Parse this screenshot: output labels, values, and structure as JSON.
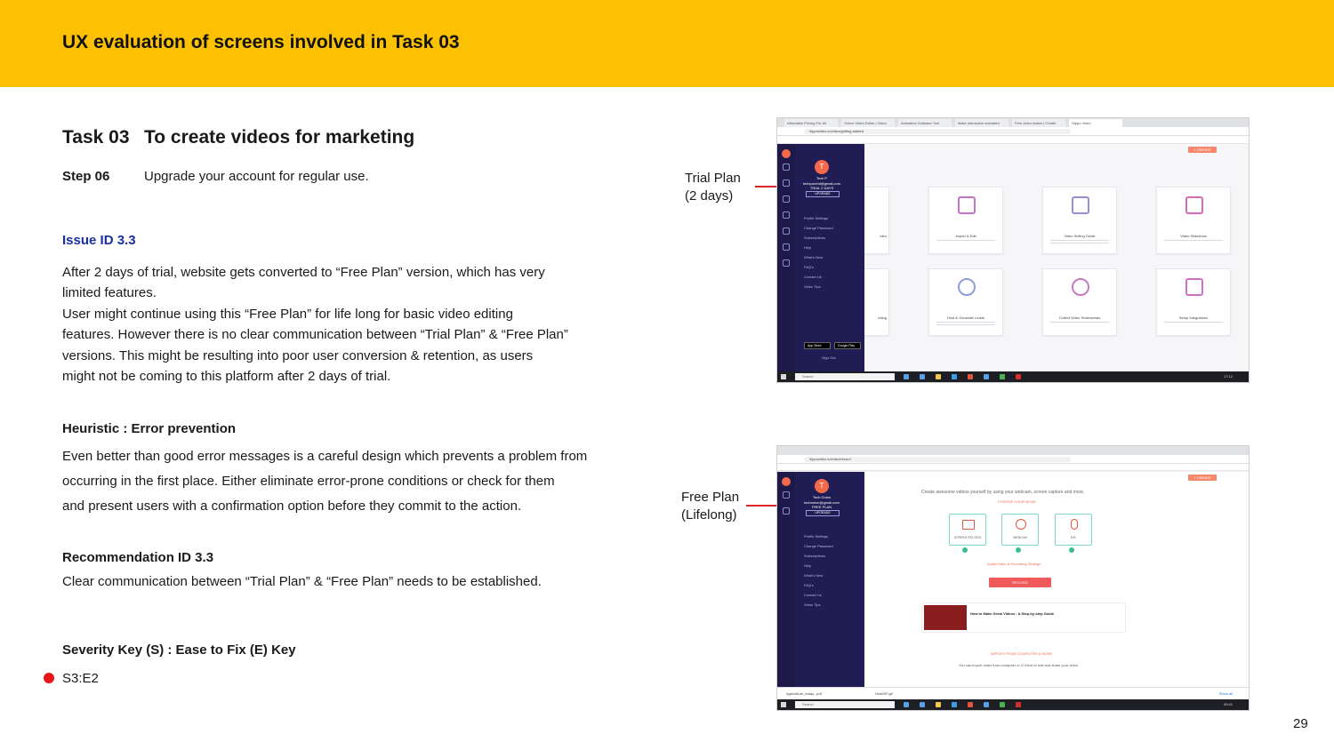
{
  "header": {
    "title": "UX evaluation of screens involved in Task 03"
  },
  "task": {
    "label": "Task 03",
    "title": "To create videos for marketing"
  },
  "step": {
    "label": "Step 06",
    "text": "Upgrade your account for regular use."
  },
  "issue": {
    "id": "Issue ID 3.3",
    "lines": [
      "After 2 days of trial,  website gets converted to “Free Plan” version, which has very",
      "limited features.",
      "User might continue using this “Free Plan” for life long for basic video editing",
      "features. However there is no clear communication between “Trial Plan” & “Free Plan”",
      "versions. This might be resulting into poor user conversion & retention, as users",
      "might not be coming to this platform after 2 days of trial."
    ]
  },
  "heuristic": {
    "title": "Heuristic : Error prevention",
    "lines": [
      "Even better than good error messages is a careful design which prevents a problem from",
      "occurring in the first place. Either eliminate error-prone conditions or check for them",
      "and present users with a confirmation option before they commit to the action."
    ]
  },
  "recommendation": {
    "title": "Recommendation ID 3.3",
    "text": "Clear communication between “Trial Plan” & “Free Plan” needs to be established."
  },
  "severity": {
    "title": "Severity Key (S) : Ease to Fix (E) Key",
    "value": "S3:E2",
    "dot_color": "#e8161b"
  },
  "page_number": "29",
  "annotations": {
    "trial": {
      "line1": "Trial Plan",
      "line2": "(2 days)"
    },
    "free": {
      "line1": "Free Plan",
      "line2": "(Lifelong)"
    }
  },
  "screenshot_top": {
    "url": "hippovideo.io/video/getting-started",
    "tabs": [
      "Affordable Pricing For All",
      "Online Video Editor | Video",
      "Animation Software Tool",
      "Make interactive animated",
      "Free video maker | Create",
      "Hippo Video"
    ],
    "user_initial": "T",
    "user_name": "Tech P",
    "user_email": "techpurohit@gmail.com",
    "plan": "TRIAL 2 DAYS",
    "upgrade_label": "UPGRADE",
    "menu": [
      "Profile Settings",
      "Change Password",
      "Subscriptions",
      "Help",
      "What's New",
      "FAQ's",
      "Contact Us",
      "Video Tips"
    ],
    "create_label": "+ CREATE",
    "cards": [
      {
        "label": "Import & Edit"
      },
      {
        "label": "Video Selling Guide"
      },
      {
        "label": "Video Slideshow"
      },
      {
        "label": "Host & Generate Leads"
      },
      {
        "label": "Collect Video Testimonials"
      },
      {
        "label": "Setup Integrations"
      }
    ],
    "edge_labels": [
      "ideo",
      "nding"
    ],
    "store_labels": [
      "App Store",
      "Google Play"
    ],
    "sign_out": "Sign Out",
    "taskbar_search": "Search",
    "clock": "17:12"
  },
  "screenshot_bottom": {
    "url": "hippovideo.io/video/record",
    "user_initial": "T",
    "user_name": "Tech Onion",
    "user_email": "techonion@gmail.com",
    "plan": "FREE PLAN",
    "upgrade_label": "UPGRADE",
    "menu": [
      "Profile Settings",
      "Change Password",
      "Subscriptions",
      "Help",
      "What's New",
      "FAQ's",
      "Contact Us",
      "Video Tips"
    ],
    "create_label": "+ CREATE",
    "headline": "Create awesome videos yourself by using your webcam, screen capture and more.",
    "choose_label": "CHOOSE YOUR MODE",
    "modes": [
      "SCREEN RECORD",
      "WEBCAM",
      "MIC"
    ],
    "audio_label": "Audio/Video & Recording Settings",
    "record_label": "RECORD",
    "video_title": "How to Make Great Videos : A Step-by-step Guide",
    "import_label": "IMPORT FROM COMPUTER & MORE",
    "import_text": "You can import video from computer or G Drive to edit and share your video.",
    "downloads": [
      "Agriculture_today...pdf",
      "HowGIF.gif"
    ],
    "show_all": "Show all",
    "taskbar_search": "Search",
    "clock": "09:41"
  }
}
